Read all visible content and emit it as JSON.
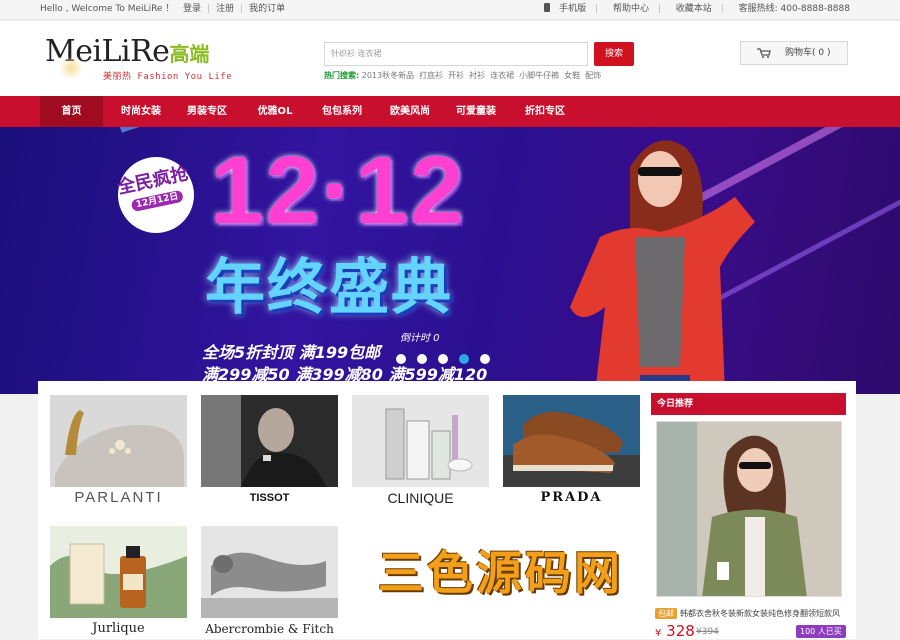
{
  "topbar": {
    "welcome": "Hello , Welcome To MeiLiRe ！",
    "links": [
      "登录",
      "注册",
      "我的订单"
    ],
    "right": [
      "手机版",
      "帮助中心",
      "收藏本站",
      "客服热线: 400-8888-8888"
    ]
  },
  "header": {
    "logo_brand": "MeiLiRe",
    "logo_cn": "高端",
    "logo_slogan": "美丽热 Fashion You Life",
    "search_placeholder": "针织衫 连衣裙",
    "search_button": "搜索",
    "hot_label": "热门搜索:",
    "hot_keywords": [
      "2013秋冬新品",
      "打底衫",
      "开衫",
      "衬衫",
      "连衣裙",
      "小脚牛仔裤",
      "女鞋",
      "配饰"
    ],
    "cart_label": "购物车( 0 )"
  },
  "nav": {
    "items": [
      "首页",
      "时尚女装",
      "男装专区",
      "优雅OL",
      "包包系列",
      "欧美风尚",
      "可爱童装",
      "折扣专区"
    ],
    "active_index": 0
  },
  "banner": {
    "badge": "全民疯抢",
    "badge_date": "12月12日",
    "date": "12·12",
    "event": "年终盛典",
    "countdown": "倒计时 0",
    "promo_line1": "全场5折封顶 满199包邮",
    "promo_line2": "满299减50 满399减80 满599减120",
    "active_slide": 3,
    "slide_count": 5
  },
  "brands": [
    {
      "name": "PARLANTI"
    },
    {
      "name": "TISSOT"
    },
    {
      "name": "CLINIQUE"
    },
    {
      "name": "PRADA"
    },
    {
      "name": "Jurlique"
    },
    {
      "name": "Abercrombie & Fitch"
    }
  ],
  "watermark": "三色源码网",
  "today": {
    "title": "今日推荐",
    "tag": "包邮",
    "desc": "韩都衣舍秋冬装新款女装纯色修身翻领短款风",
    "currency": "¥",
    "price": "328",
    "old_price": "¥394",
    "sold": "100 人已买"
  },
  "colors": {
    "brand_red": "#c8102e",
    "accent_green": "#8cbb21",
    "promo_purple": "#8e3cc0"
  }
}
